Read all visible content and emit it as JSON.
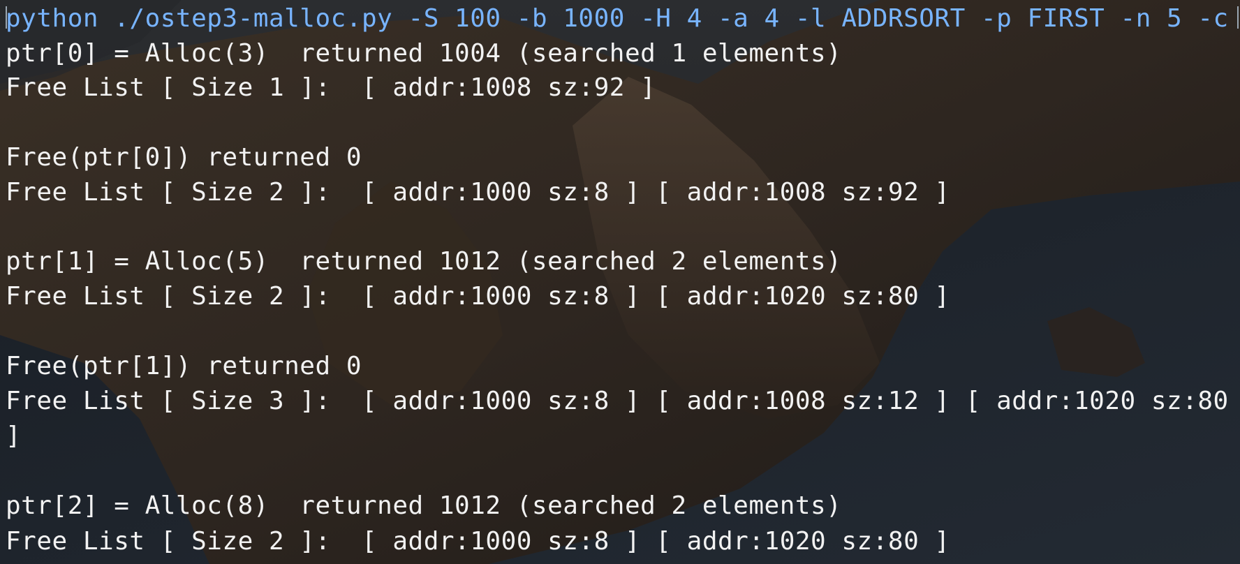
{
  "terminal": {
    "command": "python ./ostep3-malloc.py -S 100 -b 1000 -H 4 -a 4 -l ADDRSORT -p FIRST -n 5 -c",
    "lines": [
      "ptr[0] = Alloc(3)  returned 1004 (searched 1 elements)",
      "Free List [ Size 1 ]:  [ addr:1008 sz:92 ]",
      "",
      "Free(ptr[0]) returned 0",
      "Free List [ Size 2 ]:  [ addr:1000 sz:8 ] [ addr:1008 sz:92 ]",
      "",
      "ptr[1] = Alloc(5)  returned 1012 (searched 2 elements)",
      "Free List [ Size 2 ]:  [ addr:1000 sz:8 ] [ addr:1020 sz:80 ]",
      "",
      "Free(ptr[1]) returned 0",
      "Free List [ Size 3 ]:  [ addr:1000 sz:8 ] [ addr:1008 sz:12 ] [ addr:1020 sz:80",
      "]",
      "",
      "ptr[2] = Alloc(8)  returned 1012 (searched 2 elements)",
      "Free List [ Size 2 ]:  [ addr:1000 sz:8 ] [ addr:1020 sz:80 ]"
    ]
  },
  "colors": {
    "command_text": "#78b4ff",
    "output_text": "#f2f2f2",
    "background": "#1f2226"
  }
}
